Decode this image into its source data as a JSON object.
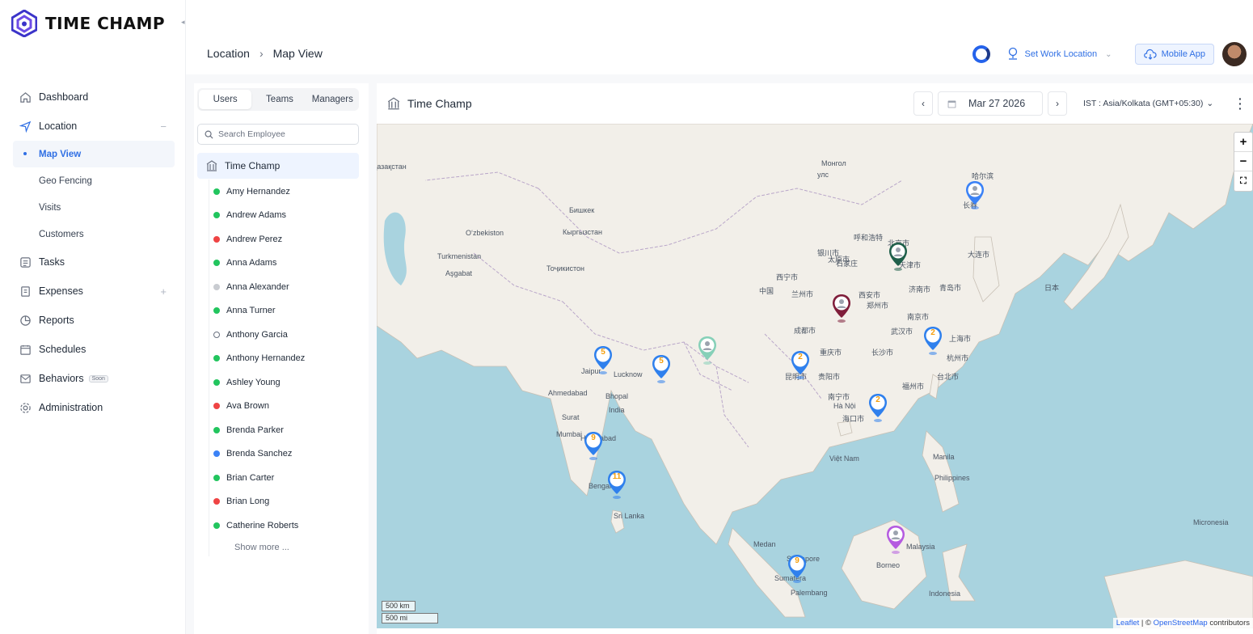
{
  "brand": {
    "name": "TIME CHAMP"
  },
  "nav": {
    "dashboard": "Dashboard",
    "location": "Location",
    "location_sub": [
      "Map View",
      "Geo Fencing",
      "Visits",
      "Customers"
    ],
    "tasks": "Tasks",
    "expenses": "Expenses",
    "reports": "Reports",
    "schedules": "Schedules",
    "behaviors": "Behaviors",
    "behaviors_badge": "Soon",
    "administration": "Administration"
  },
  "breadcrumb": {
    "parent": "Location",
    "current": "Map View"
  },
  "header": {
    "set_work_location": "Set Work Location",
    "mobile_app": "Mobile App"
  },
  "panel": {
    "tabs": [
      "Users",
      "Teams",
      "Managers"
    ],
    "search_placeholder": "Search Employee",
    "org_name": "Time Champ",
    "employees": [
      {
        "name": "Amy Hernandez",
        "status_color": "#22c55e"
      },
      {
        "name": "Andrew Adams",
        "status_color": "#22c55e"
      },
      {
        "name": "Andrew Perez",
        "status_color": "#ef4444"
      },
      {
        "name": "Anna Adams",
        "status_color": "#22c55e"
      },
      {
        "name": "Anna Alexander",
        "status_color": "#c9ccd1"
      },
      {
        "name": "Anna Turner",
        "status_color": "#22c55e"
      },
      {
        "name": "Anthony Garcia",
        "status_color": "hollow"
      },
      {
        "name": "Anthony Hernandez",
        "status_color": "#22c55e"
      },
      {
        "name": "Ashley Young",
        "status_color": "#22c55e"
      },
      {
        "name": "Ava Brown",
        "status_color": "#ef4444"
      },
      {
        "name": "Brenda Parker",
        "status_color": "#22c55e"
      },
      {
        "name": "Brenda Sanchez",
        "status_color": "#3b82f6"
      },
      {
        "name": "Brian Carter",
        "status_color": "#22c55e"
      },
      {
        "name": "Brian Long",
        "status_color": "#ef4444"
      },
      {
        "name": "Catherine Roberts",
        "status_color": "#22c55e"
      }
    ],
    "show_more": "Show more ..."
  },
  "map_panel": {
    "title": "Time Champ",
    "date": "Mar 27 2026",
    "timezone": "IST : Asia/Kolkata (GMT+05:30)",
    "scale_km": "500 km",
    "scale_mi": "500 mi",
    "attribution_leaflet": "Leaflet",
    "attribution_sep": " | © ",
    "attribution_osm": "OpenStreetMap",
    "attribution_tail": " contributors",
    "labels": [
      "Қазақстан",
      "Монгол",
      "улс",
      "Бишкек",
      "Кыргызстан",
      "Oʻzbekiston",
      "Turkmenistan",
      "Aşgabat",
      "Тоҷикистон",
      "Jaipur",
      "Lucknow",
      "Ahmedabad",
      "Bhopal",
      "India",
      "Surat",
      "Mumbai",
      "Hyderabad",
      "Bengaluru",
      "Sri Lanka",
      "Medan",
      "Singapore",
      "Sumatera",
      "Palembang",
      "Borneo",
      "Indonesia",
      "Malaysia",
      "Philippines",
      "Manila",
      "Việt Nam",
      "Hà Nội",
      "Micronesia",
      "中国",
      "哈尔滨",
      "长春",
      "北京市",
      "天津市",
      "济南市",
      "郑州市",
      "武汉市",
      "南京市",
      "成都市",
      "重庆市",
      "长沙市",
      "昆明市",
      "贵阳市",
      "南宁市",
      "海口市",
      "台北市",
      "日本",
      "大连市",
      "青岛市",
      "上海市",
      "杭州市",
      "福州市",
      "呼和浩特",
      "银川市",
      "兰州市",
      "西宁市",
      "太原市",
      "石家庄",
      "西安市"
    ],
    "clusters": [
      "5",
      "5",
      "9",
      "11",
      "2",
      "2",
      "2",
      "9"
    ]
  },
  "colors": {
    "accent": "#2f6fe4",
    "marker_blue": "#2f80ed",
    "cluster_text": "#f59e0b"
  }
}
